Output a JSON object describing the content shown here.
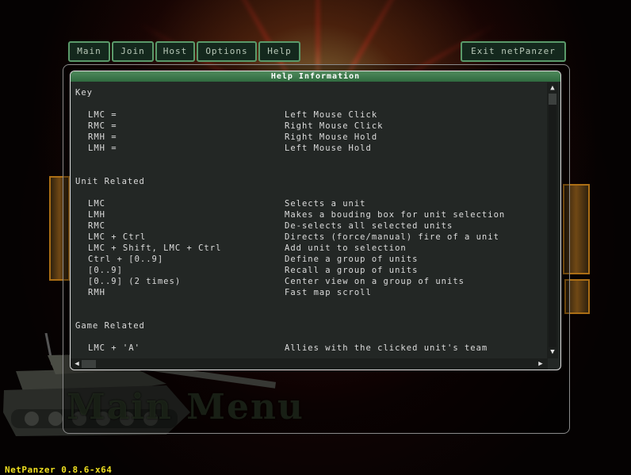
{
  "nav": {
    "tabs": [
      {
        "label": "Main"
      },
      {
        "label": "Join"
      },
      {
        "label": "Host"
      },
      {
        "label": "Options"
      },
      {
        "label": "Help"
      }
    ],
    "exit_label": "Exit netPanzer"
  },
  "help": {
    "title": "Help Information",
    "sections": {
      "key": {
        "heading": "Key",
        "rows": [
          {
            "key": "LMC =",
            "desc": "Left Mouse Click"
          },
          {
            "key": "RMC =",
            "desc": "Right Mouse Click"
          },
          {
            "key": "RMH =",
            "desc": "Right Mouse Hold"
          },
          {
            "key": "LMH =",
            "desc": "Left Mouse Hold"
          }
        ]
      },
      "unit": {
        "heading": "Unit Related",
        "rows": [
          {
            "key": "LMC",
            "desc": "Selects a unit"
          },
          {
            "key": "LMH",
            "desc": "Makes a bouding box for unit selection"
          },
          {
            "key": "RMC",
            "desc": "De-selects all selected units"
          },
          {
            "key": "LMC + Ctrl",
            "desc": "Directs (force/manual) fire of a unit"
          },
          {
            "key": "LMC + Shift, LMC + Ctrl",
            "desc": "Add unit to selection"
          },
          {
            "key": "Ctrl + [0..9]",
            "desc": "Define a group of units"
          },
          {
            "key": "[0..9]",
            "desc": "Recall a group of units"
          },
          {
            "key": "[0..9] (2 times)",
            "desc": "Center view on a group of units"
          },
          {
            "key": "RMH",
            "desc": "Fast map scroll"
          }
        ]
      },
      "game": {
        "heading": "Game Related",
        "rows": [
          {
            "key": "LMC + 'A'",
            "desc": "Allies with the clicked unit's team"
          }
        ]
      }
    }
  },
  "scrollbar": {
    "up_icon": "▲",
    "down_icon": "▼",
    "left_icon": "◀",
    "right_icon": "▶"
  },
  "background": {
    "logo_text": "Main Menu"
  },
  "footer": {
    "version": "NetPanzer 0.8.6-x64"
  },
  "colors": {
    "accent": "#5a9a6a",
    "panel": "#232725",
    "version_text": "#f0e020"
  }
}
